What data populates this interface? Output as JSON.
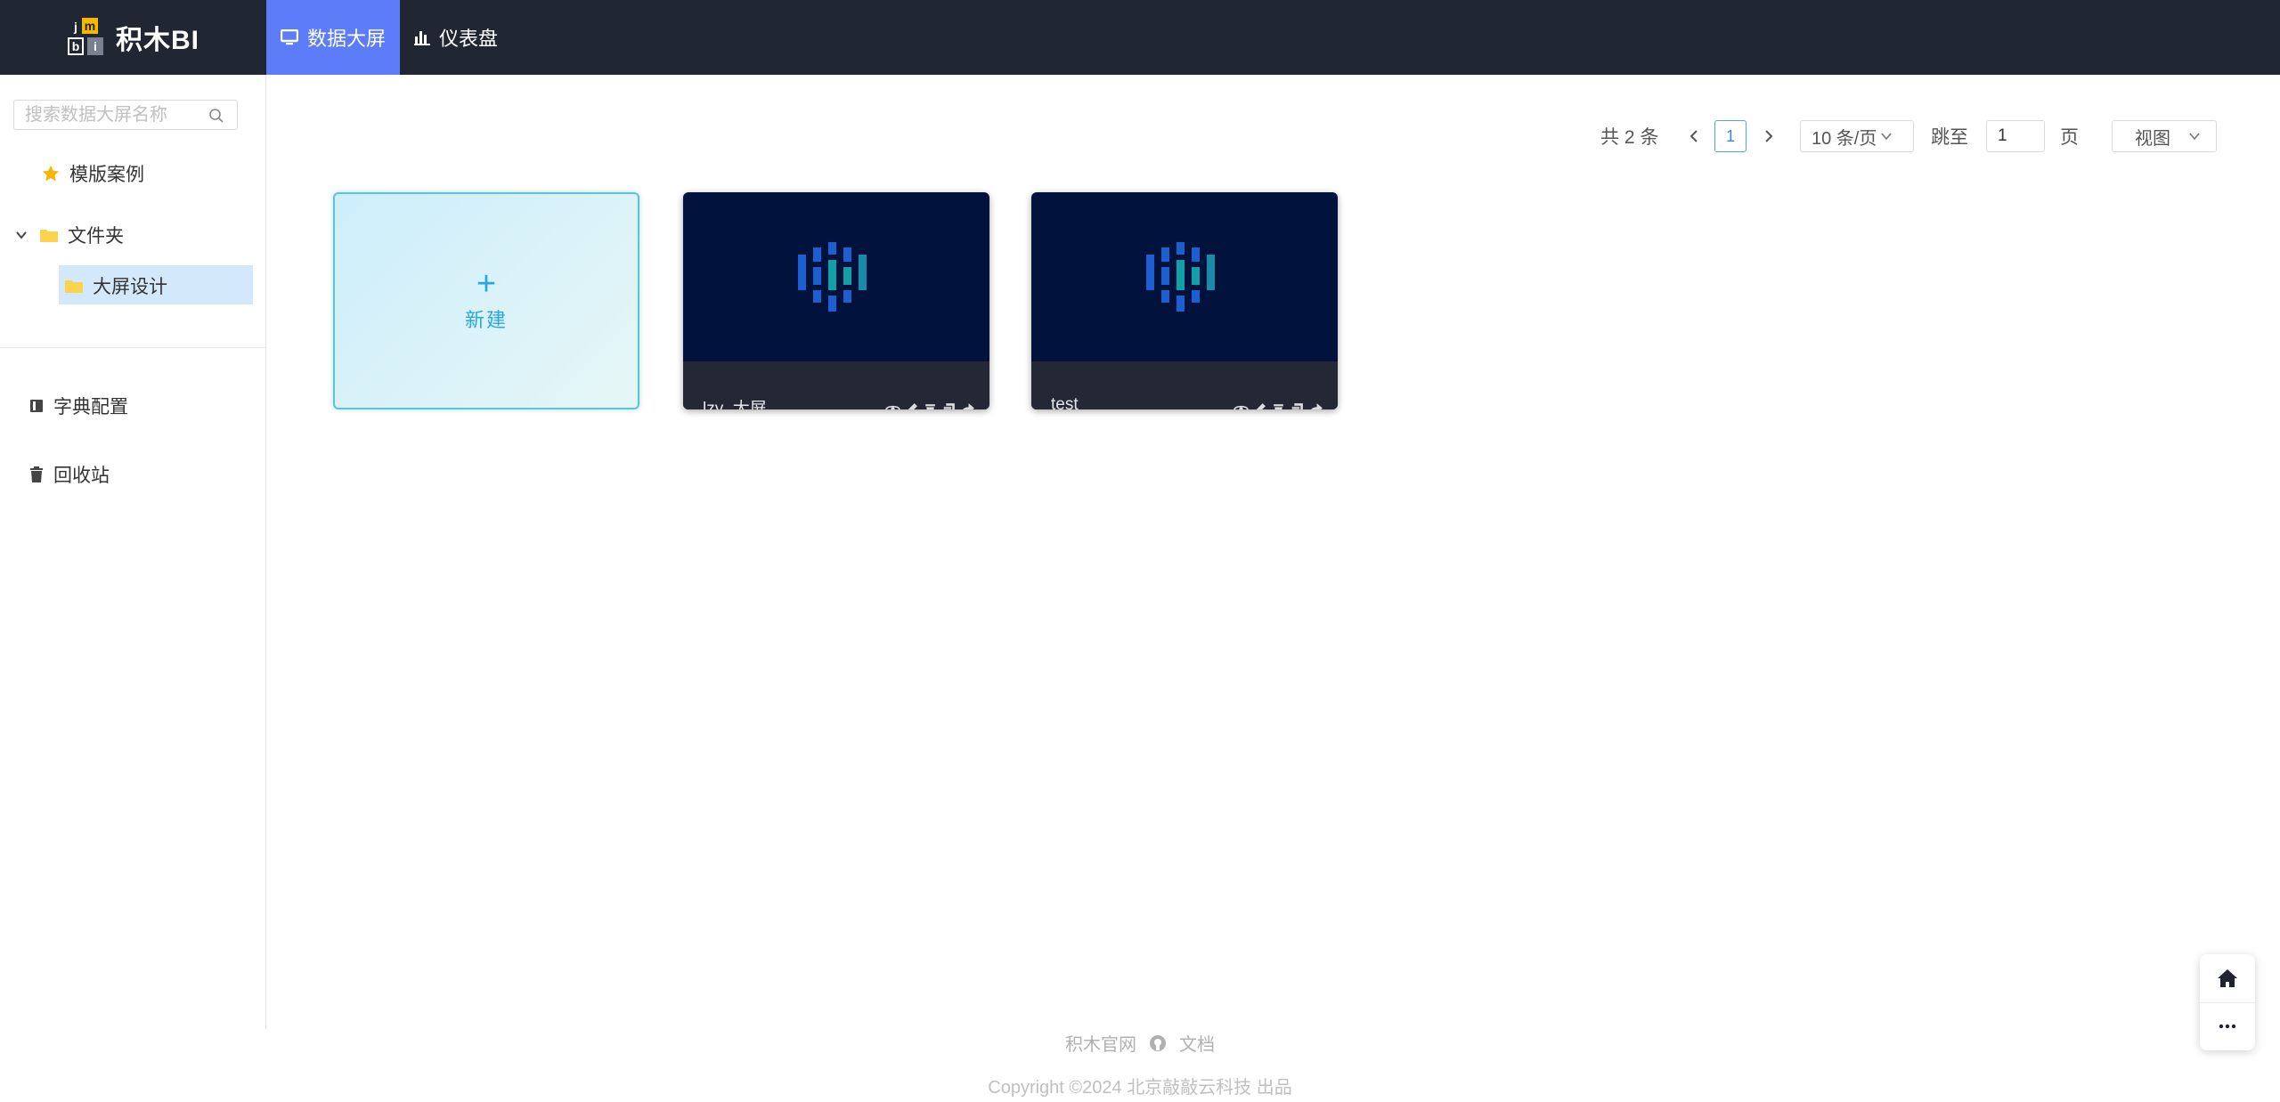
{
  "app": {
    "logo_text": "积木BI",
    "logo_letters": [
      "j",
      "m",
      "b",
      "i"
    ]
  },
  "nav": [
    {
      "label": "数据大屏",
      "icon": "monitor-icon",
      "active": true
    },
    {
      "label": "仪表盘",
      "icon": "bar-chart-icon",
      "active": false
    }
  ],
  "sidebar": {
    "search_placeholder": "搜索数据大屏名称",
    "templates_label": "模版案例",
    "folder_label": "文件夹",
    "folder_child_label": "大屏设计",
    "dict_label": "字典配置",
    "recycle_label": "回收站"
  },
  "pagination": {
    "total_label": "共 2 条",
    "current_page": "1",
    "page_size_label": "10 条/页",
    "jump_label": "跳至",
    "jump_value": "1",
    "page_suffix": "页",
    "view_label": "视图"
  },
  "cards": {
    "new_label": "新建",
    "items": [
      {
        "name": "lzy_大屏"
      },
      {
        "name": "test"
      }
    ]
  },
  "footer": {
    "site_link": "积木官网",
    "docs_link": "文档",
    "copyright": "Copyright ©2024 北京敲敲云科技 出品"
  },
  "colors": {
    "topbar": "#212732",
    "nav_active": "#5c7cfa",
    "card_dark": "#01133d",
    "accent": "#2aa7e0"
  }
}
